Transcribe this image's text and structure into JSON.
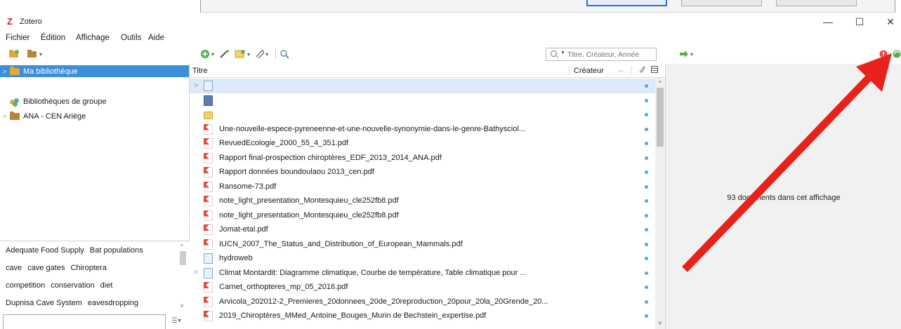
{
  "window": {
    "title": "Zotero",
    "logo_letter": "Z",
    "minimize": "—",
    "maximize": "☐",
    "close": "✕"
  },
  "menu": {
    "fichier": "Fichier",
    "edition": "Édition",
    "affichage": "Affichage",
    "outils": "Outils",
    "aide": "Aide"
  },
  "toolbar": {
    "search_placeholder": "Titre, Créateur, Année"
  },
  "collections": {
    "my_library": "Ma bibliothèque",
    "group_libraries": "Bibliothèques de groupe",
    "group": "ANA - CEN Ariège"
  },
  "tags": [
    [
      "Adequate Food Supply",
      "Bat populations"
    ],
    [
      "cave",
      "cave gates",
      "Chiroptera"
    ],
    [
      "competition",
      "conservation",
      "diet"
    ],
    [
      "Dupnisa Cave System",
      "eavesdropping"
    ]
  ],
  "columns": {
    "title": "Titre",
    "creator": "Créateur"
  },
  "items": [
    {
      "type": "doc",
      "title": "",
      "twisty": ">",
      "selected": true
    },
    {
      "type": "notebook",
      "title": ""
    },
    {
      "type": "folder",
      "title": ""
    },
    {
      "type": "pdf",
      "title": "Une-nouvelle-espece-pyreneenne-et-une-nouvelle-synonymie-dans-le-genre-Bathysciol..."
    },
    {
      "type": "pdf",
      "title": "RevuedEcologie_2000_55_4_351.pdf"
    },
    {
      "type": "pdf",
      "title": "Rapport final-prospection chiroptères_EDF_2013_2014_ANA.pdf"
    },
    {
      "type": "pdf",
      "title": "Rapport données boundoulaou 2013_cen.pdf"
    },
    {
      "type": "pdf",
      "title": "Ransome-73.pdf"
    },
    {
      "type": "pdf",
      "title": "note_light_presentation_Montesquieu_cle252fb8.pdf"
    },
    {
      "type": "pdf",
      "title": "note_light_presentation_Montesquieu_cle252fb8.pdf"
    },
    {
      "type": "pdf",
      "title": "Jomat-etal.pdf"
    },
    {
      "type": "pdf",
      "title": "IUCN_2007_The_Status_and_Distribution_of_European_Mammals.pdf"
    },
    {
      "type": "web",
      "title": "hydroweb"
    },
    {
      "type": "doc",
      "title": "Climat Montardit: Diagramme climatique, Courbe de température, Table climatique pour ...",
      "twisty": ">"
    },
    {
      "type": "pdf",
      "title": "Carnet_orthopteres_mp_05_2016.pdf"
    },
    {
      "type": "pdf",
      "title": "Arvicola_202012-2_Premieres_20donnees_20de_20reproduction_20pour_20la_20Grende_20..."
    },
    {
      "type": "pdf",
      "title": "2019_Chiroptères_MMed_Antoine_Bouges_Murin de Bechstein_expertise.pdf"
    }
  ],
  "right_pane": {
    "count_text": "93 documents dans cet affichage"
  },
  "colors": {
    "selection": "#3b8fd9",
    "arrow": "#e8221a"
  }
}
